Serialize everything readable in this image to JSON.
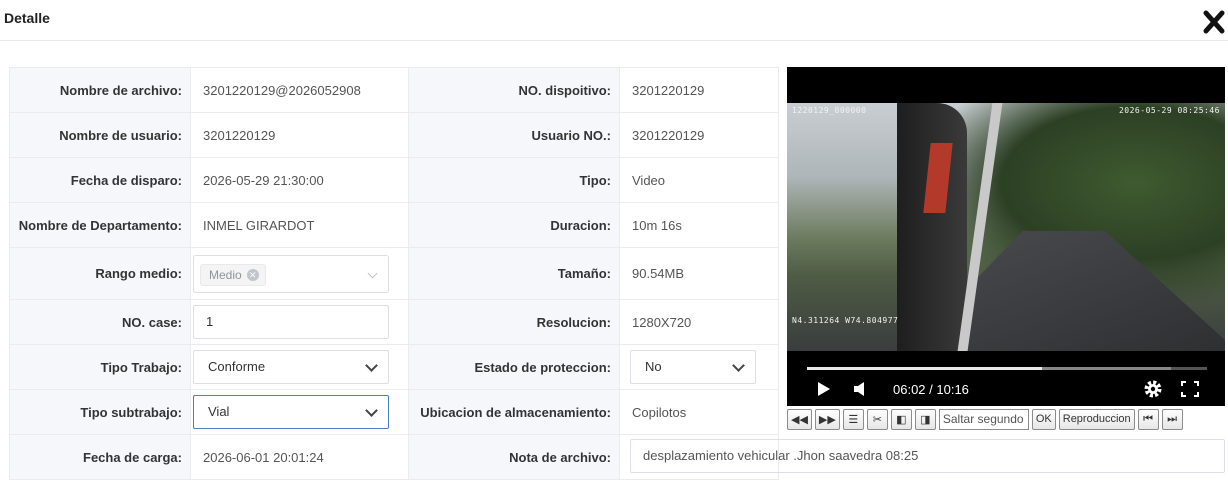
{
  "header": {
    "title": "Detalle"
  },
  "fields": {
    "nombre_archivo": {
      "label": "Nombre de archivo:",
      "value": "3201220129@2026052908"
    },
    "no_dispositivo": {
      "label": "NO. dispoitivo:",
      "value": "3201220129"
    },
    "nombre_usuario": {
      "label": "Nombre de usuario:",
      "value": "3201220129"
    },
    "usuario_no": {
      "label": "Usuario NO.:",
      "value": "3201220129"
    },
    "fecha_disparo": {
      "label": "Fecha de disparo:",
      "value": "2026-05-29 21:30:00"
    },
    "tipo": {
      "label": "Tipo:",
      "value": "Video"
    },
    "departamento": {
      "label": "Nombre de Departamento:",
      "value": "INMEL GIRARDOT"
    },
    "duracion": {
      "label": "Duracion:",
      "value": "10m 16s"
    },
    "rango_medio": {
      "label": "Rango medio:",
      "tag": "Medio"
    },
    "tamano": {
      "label": "Tamaño:",
      "value": "90.54MB"
    },
    "no_case": {
      "label": "NO. case:",
      "value": "1"
    },
    "resolucion": {
      "label": "Resolucion:",
      "value": "1280X720"
    },
    "tipo_trabajo": {
      "label": "Tipo Trabajo:",
      "value": "Conforme"
    },
    "estado_proteccion": {
      "label": "Estado de proteccion:",
      "value": "No"
    },
    "tipo_subtrabajo": {
      "label": "Tipo subtrabajo:",
      "value": "Vial"
    },
    "ubicacion": {
      "label": "Ubicacion de almacenamiento:",
      "value": "Copilotos"
    },
    "fecha_carga": {
      "label": "Fecha de carga:",
      "value": "2026-06-01 20:01:24"
    },
    "nota": {
      "label": "Nota de archivo:",
      "value": "desplazamiento vehicular .Jhon saavedra 08:25"
    }
  },
  "player": {
    "osd_top_left": "1220129_000000",
    "osd_top_right": "2026-05-29 08:25:46",
    "osd_bottom_left": "N4.311264  W74.804977",
    "time": "06:02 / 10:16",
    "progress_fraction": 0.587,
    "buffered_fraction": 0.91
  },
  "toolbar": {
    "seek_placeholder": "Saltar segundo",
    "ok_label": "OK",
    "playback_label": "Reproduccion"
  },
  "colors": {
    "focus_border": "#4a7fc1",
    "label_bg": "#f5f7fa",
    "border": "#ebebeb"
  }
}
